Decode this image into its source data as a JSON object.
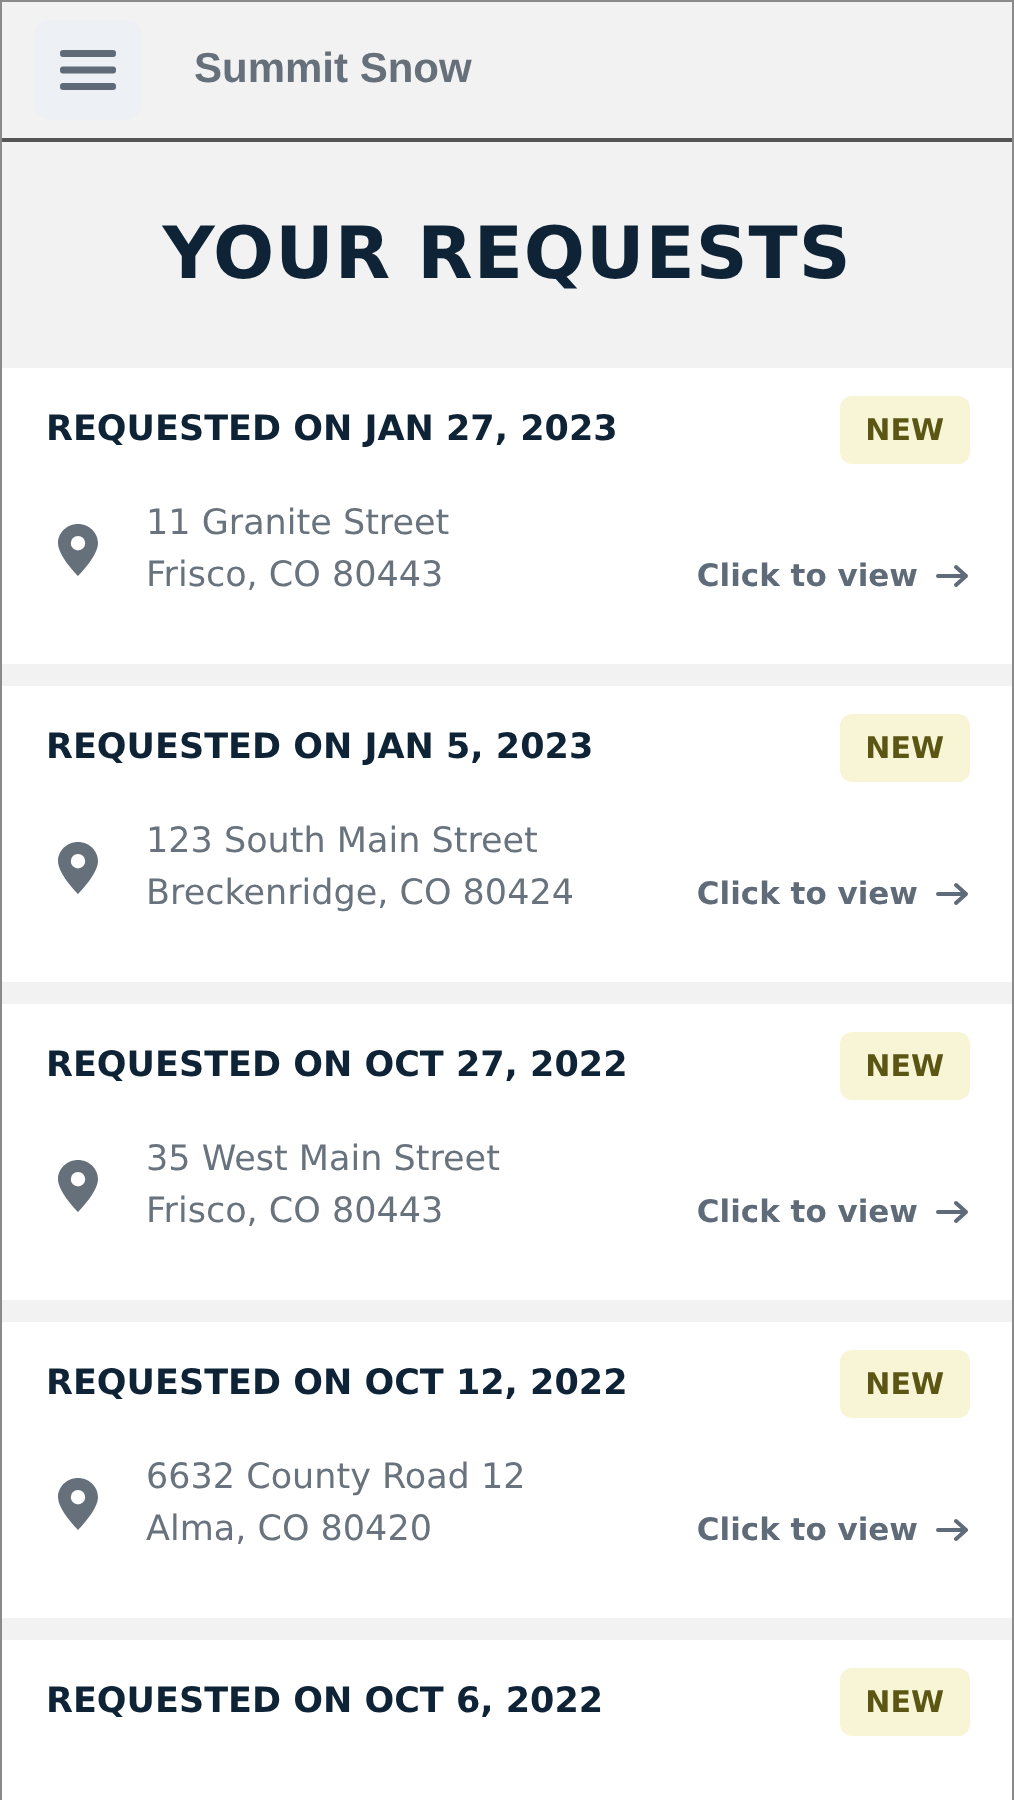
{
  "app_bar": {
    "title": "Summit Snow"
  },
  "page_title": "YOUR REQUESTS",
  "requests": [
    {
      "heading": "REQUESTED ON JAN 27, 2023",
      "badge": "NEW",
      "address_line_1": "11 Granite Street",
      "address_line_2": "Frisco, CO 80443",
      "link": "Click to view"
    },
    {
      "heading": "REQUESTED ON JAN 5, 2023",
      "badge": "NEW",
      "address_line_1": "123 South Main Street",
      "address_line_2": "Breckenridge, CO 80424",
      "link": "Click to view"
    },
    {
      "heading": "REQUESTED ON OCT 27, 2022",
      "badge": "NEW",
      "address_line_1": "35 West Main Street",
      "address_line_2": "Frisco, CO 80443",
      "link": "Click to view"
    },
    {
      "heading": "REQUESTED ON OCT 12, 2022",
      "badge": "NEW",
      "address_line_1": "6632 County Road 12",
      "address_line_2": "Alma, CO 80420",
      "link": "Click to view"
    },
    {
      "heading": "REQUESTED ON OCT 6, 2022",
      "badge": "NEW"
    }
  ]
}
